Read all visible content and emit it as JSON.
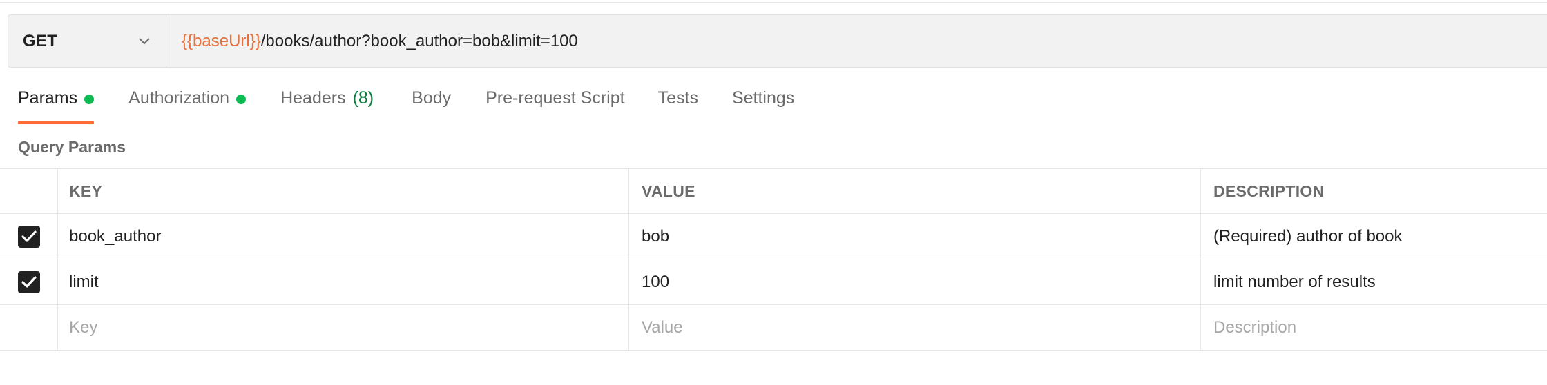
{
  "request": {
    "method": "GET",
    "url_variable": "{{baseUrl}}",
    "url_path": "/books/author?book_author=bob&limit=100"
  },
  "tabs": [
    {
      "label": "Params",
      "active": true,
      "dot": true
    },
    {
      "label": "Authorization",
      "dot": true
    },
    {
      "label": "Headers",
      "count": "(8)"
    },
    {
      "label": "Body"
    },
    {
      "label": "Pre-request Script"
    },
    {
      "label": "Tests"
    },
    {
      "label": "Settings"
    }
  ],
  "query_params": {
    "title": "Query Params",
    "columns": {
      "key": "KEY",
      "value": "VALUE",
      "description": "DESCRIPTION"
    },
    "rows": [
      {
        "checked": true,
        "key": "book_author",
        "value": "bob",
        "description": "(Required) author of book"
      },
      {
        "checked": true,
        "key": "limit",
        "value": "100",
        "description": "limit number of results"
      }
    ],
    "placeholders": {
      "key": "Key",
      "value": "Value",
      "description": "Description"
    }
  },
  "colors": {
    "accent": "#ff6c37",
    "variable": "#e8703a",
    "status_dot": "#0cbb52",
    "count": "#0a7f3f"
  },
  "icons": {
    "method_dropdown": "chevron-down-icon",
    "checkbox": "checkmark-icon"
  }
}
